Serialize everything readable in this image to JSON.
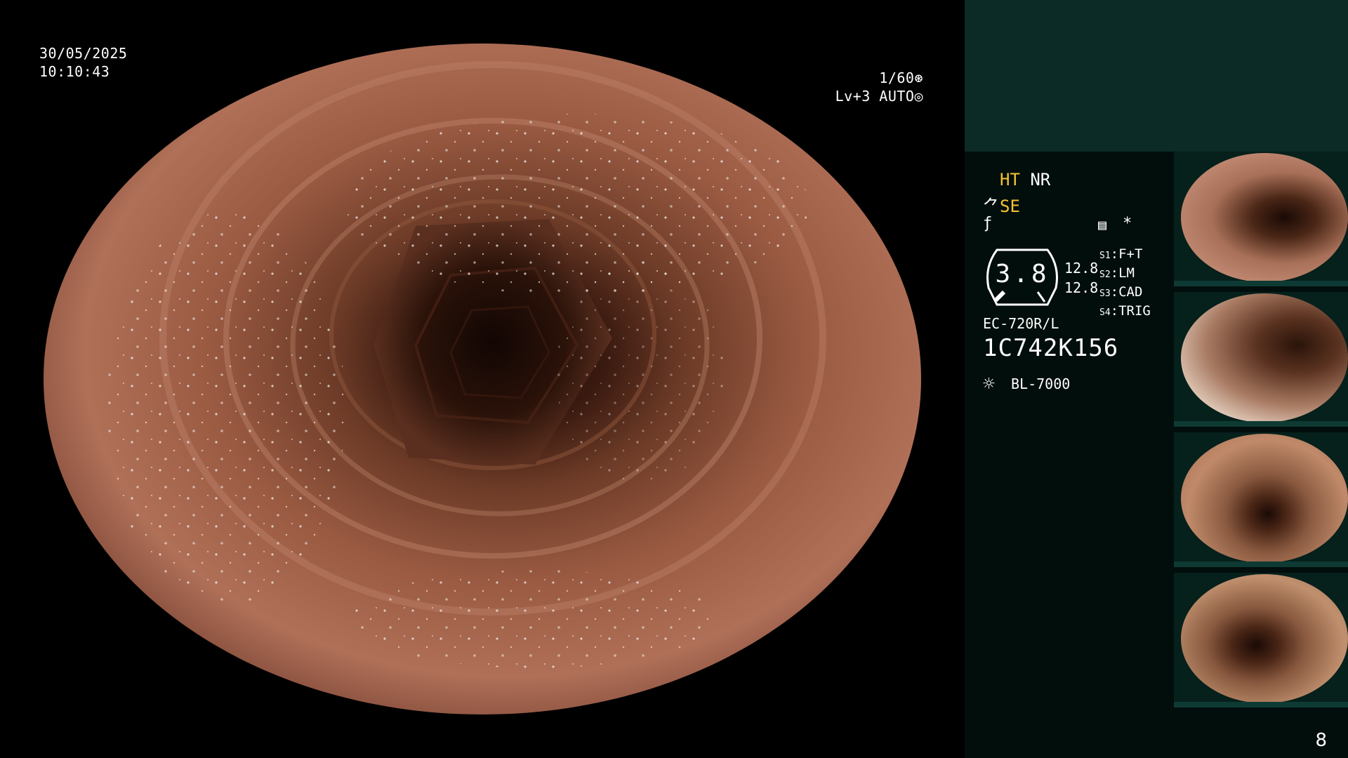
{
  "overlay": {
    "date": "30/05/2025",
    "time": "10:10:43",
    "shutter": "1/60",
    "shutter_icon": "aperture-icon",
    "level": "Lv+3 AUTO",
    "level_icon": "iris-icon"
  },
  "panel": {
    "ht": "HT",
    "nr": "NR",
    "se": "SE",
    "zoom": "3.8",
    "value_right_1": "12.8",
    "value_right_2": "12.8",
    "star": "*",
    "slots": [
      {
        "key": "S1",
        "value": "F+T"
      },
      {
        "key": "S2",
        "value": "LM"
      },
      {
        "key": "S3",
        "value": "CAD"
      },
      {
        "key": "S4",
        "value": "TRIG"
      }
    ],
    "scope_model": "EC-720R/L",
    "scope_serial": "1C742K156",
    "light_source": "BL-7000",
    "page_number": "8"
  },
  "colors": {
    "panel_top": "#0d2b26",
    "panel_bg": "#020e0c",
    "accent_yellow": "#f4c430"
  },
  "thumbnails_count": 4
}
